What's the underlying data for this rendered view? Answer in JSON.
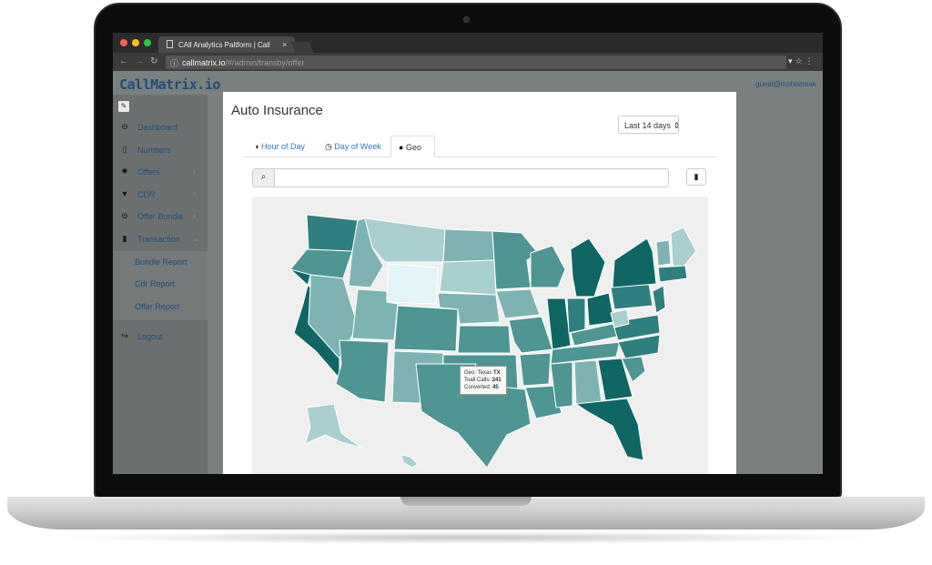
{
  "browser": {
    "tab_title": "CAll Analytics Paltform | Call",
    "url_domain": "callmatrix.io",
    "url_path": "/#/admin/transby/offer",
    "traffic_light_colors": [
      "#ff5f57",
      "#febc2e",
      "#28c840"
    ]
  },
  "app": {
    "brand": "CallMatrix.io",
    "user_email": "guest@mobistreak"
  },
  "sidebar": {
    "pin_icon": "pencil-icon",
    "items": [
      {
        "label": "Dashboard",
        "icon": "dashboard-icon",
        "glyph": "⊖",
        "chevron": ""
      },
      {
        "label": "Numbers",
        "icon": "phone-icon",
        "glyph": "▯",
        "chevron": ""
      },
      {
        "label": "Offers",
        "icon": "offers-icon",
        "glyph": "✹",
        "chevron": "›"
      },
      {
        "label": "CDR",
        "icon": "filter-icon",
        "glyph": "▼",
        "chevron": "›"
      },
      {
        "label": "Offer Bundle",
        "icon": "bundle-icon",
        "glyph": "⊜",
        "chevron": "›"
      },
      {
        "label": "Transaction",
        "icon": "bar-chart-icon",
        "glyph": "▮",
        "chevron": "⌄"
      }
    ],
    "subitems": [
      "Bundle Report",
      "Cdr Report",
      "Offer Report"
    ],
    "logout": {
      "label": "Logout",
      "icon": "logout-icon",
      "glyph": "↪"
    }
  },
  "modal": {
    "title": "Auto Insurance",
    "range_select": "Last 14 days",
    "tabs": [
      {
        "label": "Hour of Day",
        "glyph": "◑",
        "active": false
      },
      {
        "label": "Day of Week",
        "glyph": "◷",
        "active": false
      },
      {
        "label": "Geo",
        "glyph": "●",
        "active": true
      }
    ],
    "search_placeholder": "",
    "map_colors": {
      "darkest": "#0f6665",
      "dark": "#2f7f7f",
      "mid": "#4e9594",
      "light": "#7fb3b3",
      "lighter": "#a9cfcf",
      "lightest": "#e2f4f6"
    },
    "tooltip": {
      "geo_label": "Geo:",
      "geo_value": "Texas",
      "geo_code": "TX",
      "calls_label": "Toall Calls:",
      "calls_value": "241",
      "converted_label": "Converted:",
      "converted_value": "45"
    }
  }
}
